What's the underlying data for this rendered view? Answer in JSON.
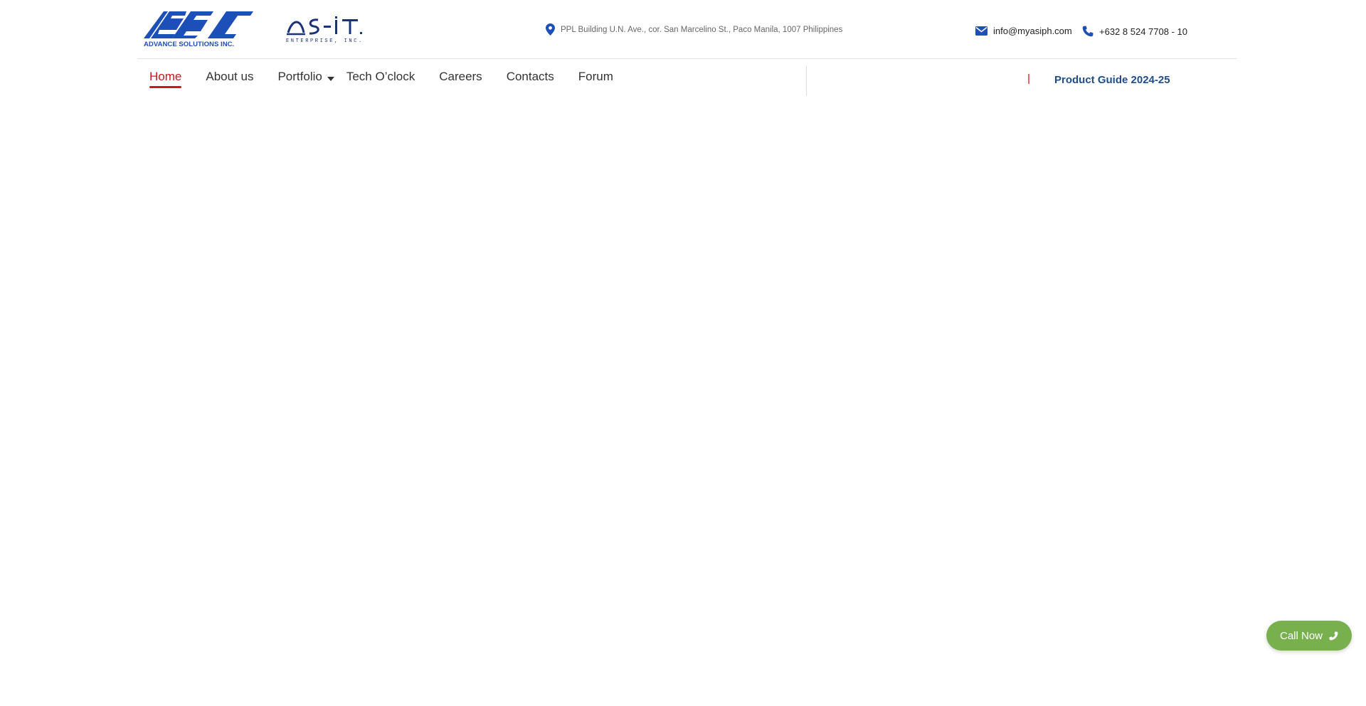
{
  "header": {
    "logo_primary_text": "ADVANCE SOLUTIONS INC.",
    "logo_secondary_text": "AS-IT ENTERPRISE, INC.",
    "address": "PPL Building U.N. Ave., cor. San Marcelino St., Paco Manila, 1007 Philippines",
    "email": "info@myasiph.com",
    "phone": "+632 8 524 7708 - 10",
    "icons": {
      "address": "map-pin-icon",
      "email": "envelope-icon",
      "phone": "phone-icon"
    }
  },
  "nav": {
    "items": [
      {
        "label": "Home",
        "active": true
      },
      {
        "label": "About us"
      },
      {
        "label": "Portfolio",
        "has_dropdown": true
      },
      {
        "label": "Tech O’clock"
      },
      {
        "label": "Careers"
      },
      {
        "label": "Contacts"
      },
      {
        "label": "Forum"
      }
    ],
    "product_guide": "Product Guide 2024-25"
  },
  "floating": {
    "call_now_label": "Call Now"
  },
  "colors": {
    "brand_blue": "#1d4fb8",
    "active_red": "#c8191f",
    "product_guide_blue": "#1f4d8c",
    "call_green": "#79b04e"
  }
}
